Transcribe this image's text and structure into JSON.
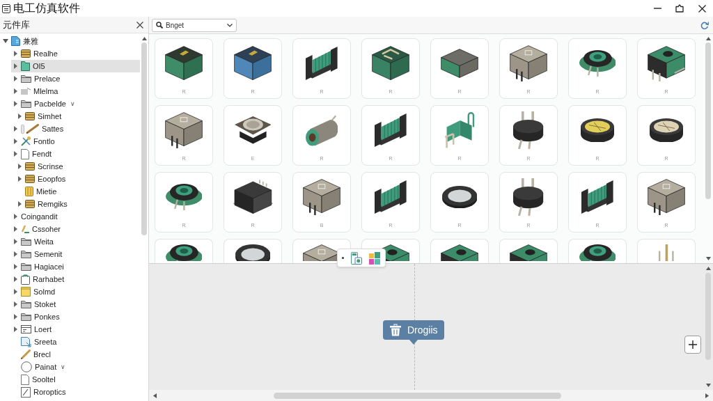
{
  "window": {
    "title": "电工仿真软件"
  },
  "library": {
    "title": "元件库",
    "tree": [
      {
        "label": "兼雅",
        "kind": "bluedoc",
        "expanded": true,
        "selected": false,
        "children": [
          {
            "label": "Realhe",
            "kind": "stack",
            "expanded": false,
            "selected": false
          },
          {
            "label": "OI5",
            "kind": "tealfolder",
            "expanded": false,
            "selected": true
          },
          {
            "label": "Prelace",
            "kind": "folder",
            "expanded": false,
            "selected": false
          },
          {
            "label": "Mlelma",
            "kind": "pages",
            "expanded": false,
            "selected": false
          },
          {
            "label": "Pacbelde",
            "kind": "folder",
            "expanded": false,
            "selected": false,
            "suffix": "∨",
            "children": [
              {
                "label": "Simhet",
                "kind": "stack",
                "expanded": false,
                "selected": false
              }
            ]
          },
          {
            "label": "Sattes",
            "kind": "tagbrush",
            "expanded": false,
            "selected": false
          },
          {
            "label": "Fontlo",
            "kind": "tools",
            "expanded": false,
            "selected": false
          },
          {
            "label": "Fendt",
            "kind": "doc",
            "expanded": false,
            "selected": false,
            "children": [
              {
                "label": "Scrinse",
                "kind": "stack",
                "expanded": false,
                "selected": false
              },
              {
                "label": "Eoopfos",
                "kind": "stack",
                "expanded": false,
                "selected": false
              },
              {
                "label": "Mietie",
                "kind": "book",
                "selected": false
              },
              {
                "label": "Remgiks",
                "kind": "stack",
                "expanded": false,
                "selected": false
              }
            ]
          },
          {
            "label": "Coingandit",
            "kind": "plain",
            "expanded": false,
            "selected": false
          },
          {
            "label": "Cssoher",
            "kind": "pen",
            "expanded": false,
            "selected": false
          },
          {
            "label": "Weita",
            "kind": "folder",
            "expanded": false,
            "selected": false
          },
          {
            "label": "Semenit",
            "kind": "folder",
            "expanded": false,
            "selected": false
          },
          {
            "label": "Hagiacei",
            "kind": "folder",
            "expanded": false,
            "selected": false
          },
          {
            "label": "Rarhabet",
            "kind": "clipboard",
            "expanded": false,
            "selected": false
          },
          {
            "label": "Solmd",
            "kind": "yellowfolder",
            "expanded": false,
            "selected": false
          },
          {
            "label": "Stoket",
            "kind": "folder",
            "expanded": false,
            "selected": false
          },
          {
            "label": "Ponkes",
            "kind": "folder",
            "expanded": false,
            "selected": false
          },
          {
            "label": "Loert",
            "kind": "window",
            "expanded": false,
            "selected": false
          },
          {
            "label": "Sreeta",
            "kind": "export",
            "selected": false
          },
          {
            "label": "Brecl",
            "kind": "brush",
            "selected": false
          },
          {
            "label": "Painat",
            "kind": "circle",
            "selected": false,
            "suffix": "∨"
          },
          {
            "label": "Sooltel",
            "kind": "doc",
            "selected": false
          },
          {
            "label": "Roroptics",
            "kind": "edit",
            "selected": false
          }
        ]
      }
    ]
  },
  "toolbar": {
    "search": {
      "value": "Bnget"
    }
  },
  "components": [
    {
      "label": "R",
      "kind": "cube"
    },
    {
      "label": "R",
      "kind": "bluecube"
    },
    {
      "label": "R",
      "kind": "coil"
    },
    {
      "label": "R",
      "kind": "cage"
    },
    {
      "label": "R",
      "kind": "block"
    },
    {
      "label": "R",
      "kind": "housing"
    },
    {
      "label": "R",
      "kind": "pot"
    },
    {
      "label": "R",
      "kind": "relay"
    },
    {
      "label": "R",
      "kind": "housing"
    },
    {
      "label": "E",
      "kind": "socket"
    },
    {
      "label": "R",
      "kind": "cylinder"
    },
    {
      "label": "R",
      "kind": "coil"
    },
    {
      "label": "R",
      "kind": "clip"
    },
    {
      "label": "R",
      "kind": "plug"
    },
    {
      "label": "R",
      "kind": "yellowdisc"
    },
    {
      "label": "R",
      "kind": "disc"
    },
    {
      "label": "R",
      "kind": "pot"
    },
    {
      "label": "R",
      "kind": "blackbox"
    },
    {
      "label": "B",
      "kind": "housing"
    },
    {
      "label": "R",
      "kind": "coil"
    },
    {
      "label": "R",
      "kind": "ring"
    },
    {
      "label": "R",
      "kind": "plug"
    },
    {
      "label": "R",
      "kind": "coil"
    },
    {
      "label": "R",
      "kind": "housing"
    },
    {
      "kind": "pot"
    },
    {
      "kind": "ring"
    },
    {
      "kind": "housing"
    },
    {
      "kind": "relay"
    },
    {
      "kind": "relay"
    },
    {
      "kind": "relay"
    },
    {
      "kind": "pot"
    },
    {
      "kind": "pins"
    }
  ],
  "canvas": {
    "tooltip": {
      "text": "Drogiis"
    }
  }
}
